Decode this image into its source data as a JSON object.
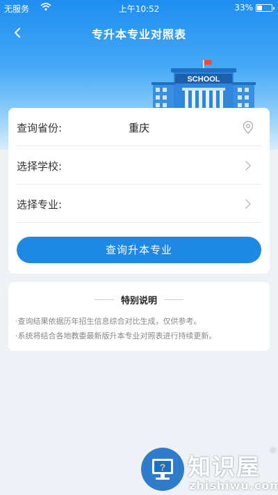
{
  "status_bar": {
    "carrier": "无服务",
    "time": "上午10:52",
    "battery_percent": "33%",
    "battery_level": 0.33
  },
  "nav": {
    "title": "专升本专业对照表",
    "back_icon": "chevron-left-icon"
  },
  "illustration": {
    "school_sign": "SCHOOL",
    "flag_color": "#e94b3c"
  },
  "form": {
    "province": {
      "label": "查询省份:",
      "value": "重庆",
      "icon": "location-pin-icon"
    },
    "school": {
      "label": "选择学校:",
      "icon": "chevron-right-icon"
    },
    "major": {
      "label": "选择专业:",
      "icon": "chevron-right-icon"
    },
    "submit_label": "查询升本专业"
  },
  "notice": {
    "title": "特别说明",
    "lines": [
      "·查询结果依据历年招生信息综合对比生成，仅供参考。",
      "·系统将结合各地教委最新版升本专业对照表进行持续更新。"
    ]
  },
  "watermark": {
    "name_cn": "知识屋",
    "reg_mark": "®",
    "domain": "zhishiwu.com"
  },
  "colors": {
    "primary": "#1e88e5",
    "header_top": "#1e8ef0",
    "background": "#eef1f5"
  }
}
